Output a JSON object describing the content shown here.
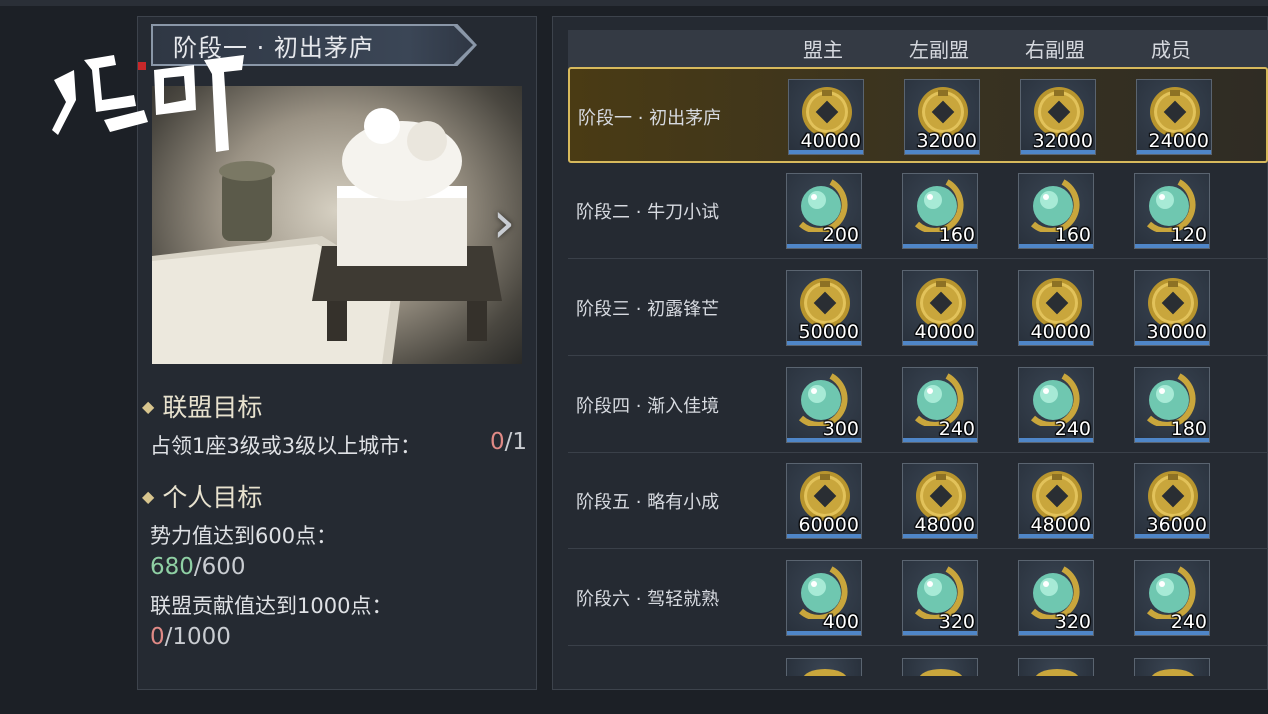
{
  "logo_text": "鸿图之下",
  "stage_panel": {
    "title": "阶段一 · 初出茅庐",
    "alliance_goal": {
      "heading": "联盟目标",
      "task": "占领1座3级或3级以上城市：",
      "current": "0",
      "total": "/1"
    },
    "personal_goal": {
      "heading": "个人目标",
      "task1": "势力值达到600点：",
      "task1_current": "680",
      "task1_total": "/600",
      "task2": "联盟贡献值达到1000点：",
      "task2_current": "0",
      "task2_total": "/1000"
    }
  },
  "table": {
    "headers": [
      "盟主",
      "左副盟",
      "右副盟",
      "成员"
    ],
    "rows": [
      {
        "label": "阶段一 · 初出茅庐",
        "icon": "copper-coin-icon",
        "values": [
          "40000",
          "32000",
          "32000",
          "24000"
        ]
      },
      {
        "label": "阶段二 · 牛刀小试",
        "icon": "jade-orb-icon",
        "values": [
          "200",
          "160",
          "160",
          "120"
        ]
      },
      {
        "label": "阶段三 · 初露锋芒",
        "icon": "copper-coin-icon",
        "values": [
          "50000",
          "40000",
          "40000",
          "30000"
        ]
      },
      {
        "label": "阶段四 · 渐入佳境",
        "icon": "jade-orb-icon",
        "values": [
          "300",
          "240",
          "240",
          "180"
        ]
      },
      {
        "label": "阶段五 · 略有小成",
        "icon": "copper-coin-icon",
        "values": [
          "60000",
          "48000",
          "48000",
          "36000"
        ]
      },
      {
        "label": "阶段六 · 驾轻就熟",
        "icon": "jade-orb-icon",
        "values": [
          "400",
          "320",
          "320",
          "240"
        ]
      }
    ]
  },
  "colors": {
    "selected_border": "#d7b95c",
    "progress_incomplete": "#e08a86",
    "progress_complete": "#8fd0a4",
    "reward_bar": "#4f86c8"
  }
}
